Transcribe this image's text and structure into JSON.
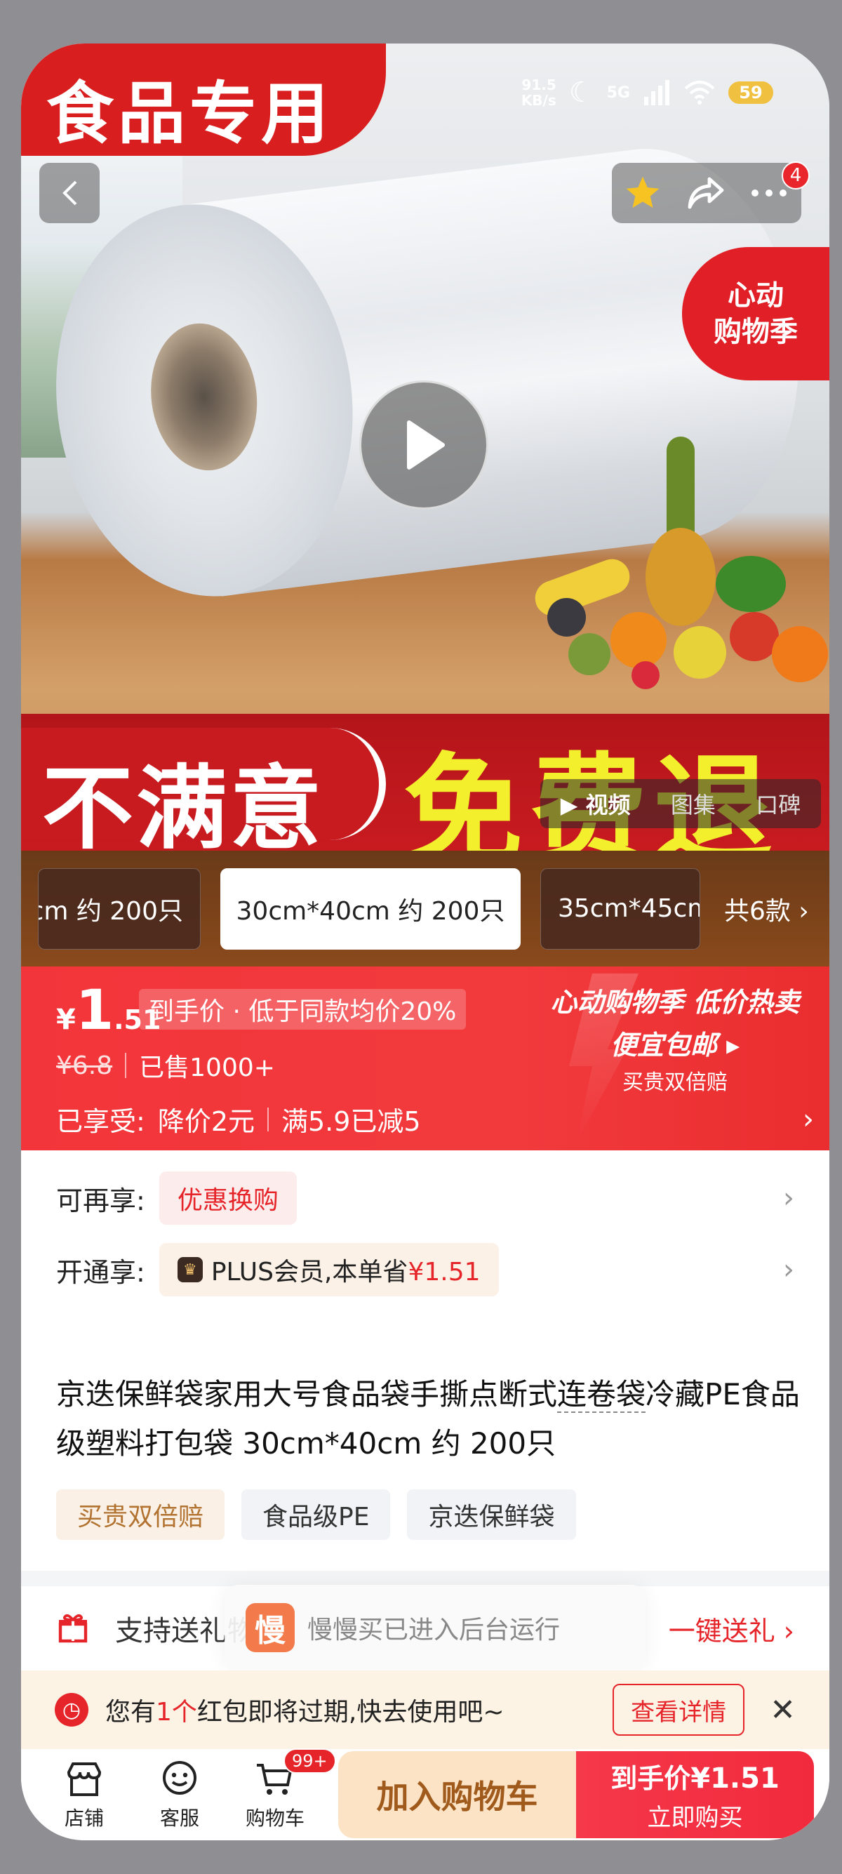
{
  "status_bar": {
    "speed_value": "91.5",
    "speed_unit": "KB/s",
    "network": "5G",
    "battery": "59"
  },
  "hero": {
    "corner_badge": "食品专用",
    "promo_line1": "心动",
    "promo_line2": "购物季",
    "banner_left": "不满意",
    "banner_right": "免费退",
    "notification_count": "4",
    "media_tabs": [
      {
        "label": "视频",
        "active": true
      },
      {
        "label": "图集",
        "active": false
      },
      {
        "label": "口碑",
        "active": false
      }
    ]
  },
  "variants": {
    "items": [
      {
        "label": "cm 约 200只"
      },
      {
        "label": "30cm*40cm 约 200只"
      },
      {
        "label": "35cm*45cm"
      }
    ],
    "total": "共6款"
  },
  "price": {
    "currency": "¥",
    "integer": "1",
    "decimal": ".51",
    "tag": "到手价 · 低于同款均价20%",
    "original": "¥6.8",
    "sold": "已售1000+",
    "enjoy_label": "已享受:",
    "enjoy_discount": "降价2元",
    "enjoy_full": "满5.9已减5",
    "promo_title": "心动购物季 低价热卖",
    "promo_sub": "便宜包邮 ▸",
    "promo_guarantee": "买贵双倍赔"
  },
  "rows": {
    "more_label": "可再享:",
    "more_chip": "优惠换购",
    "plus_label": "开通享:",
    "plus_text": "PLUS会员,本单省",
    "plus_amount": "¥1.51"
  },
  "product": {
    "title_part1": "京迭保鲜袋家用大号食品袋手撕点断式",
    "title_dashed": "连卷袋",
    "title_part2": "冷藏PE食品级塑料打包袋 30cm*40cm 约 200只",
    "tags": [
      "买贵双倍赔",
      "食品级PE",
      "京迭保鲜袋"
    ]
  },
  "gift": {
    "text": "支持送礼物",
    "cta": "一键送礼"
  },
  "toast": {
    "logo": "慢",
    "text": "慢慢买已进入后台运行"
  },
  "redpack": {
    "prefix": "您有",
    "count": "1个",
    "suffix": "红包即将过期,快去使用吧~",
    "button": "查看详情"
  },
  "bottom": {
    "shop": "店铺",
    "service": "客服",
    "cart": "购物车",
    "cart_badge": "99+",
    "add_cart": "加入购物车",
    "buy_price_label": "到手价",
    "buy_price_yen": "¥",
    "buy_price": "1.51",
    "buy_now": "立即购买"
  },
  "colors": {
    "brand_red": "#e5252a",
    "banner_yellow": "#f3ef2d",
    "plus_gold": "#b27331"
  }
}
